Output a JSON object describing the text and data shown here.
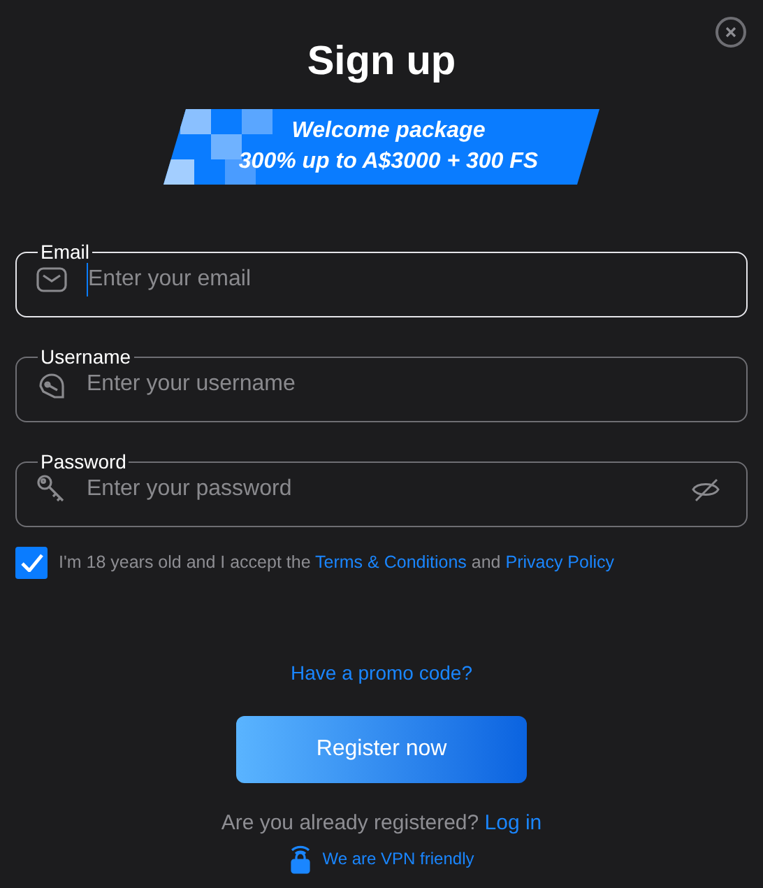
{
  "title": "Sign up",
  "banner": {
    "line_1": "Welcome package",
    "line_2": "300% up to A$3000 + 300 FS"
  },
  "fields": [
    {
      "kind": "email",
      "label": "Email",
      "placeholder": "Enter your email",
      "focused": true
    },
    {
      "kind": "username",
      "label": "Username",
      "placeholder": "Enter your username",
      "focused": false
    },
    {
      "kind": "password",
      "label": "Password",
      "placeholder": "Enter your password",
      "focused": false
    }
  ],
  "consent": {
    "checked": true,
    "parts": [
      {
        "kind": "text",
        "text": "I'm 18 years old and I accept the"
      },
      {
        "kind": "link",
        "text": "Terms & Conditions"
      },
      {
        "kind": "text",
        "text": "and"
      },
      {
        "kind": "link",
        "text": "Privacy Policy"
      }
    ]
  },
  "promo_link": "Have a promo code?",
  "register_button": "Register now",
  "login_prompt": {
    "text": "Are you already registered?",
    "link": "Log in"
  },
  "vpn_note": "We are VPN friendly"
}
